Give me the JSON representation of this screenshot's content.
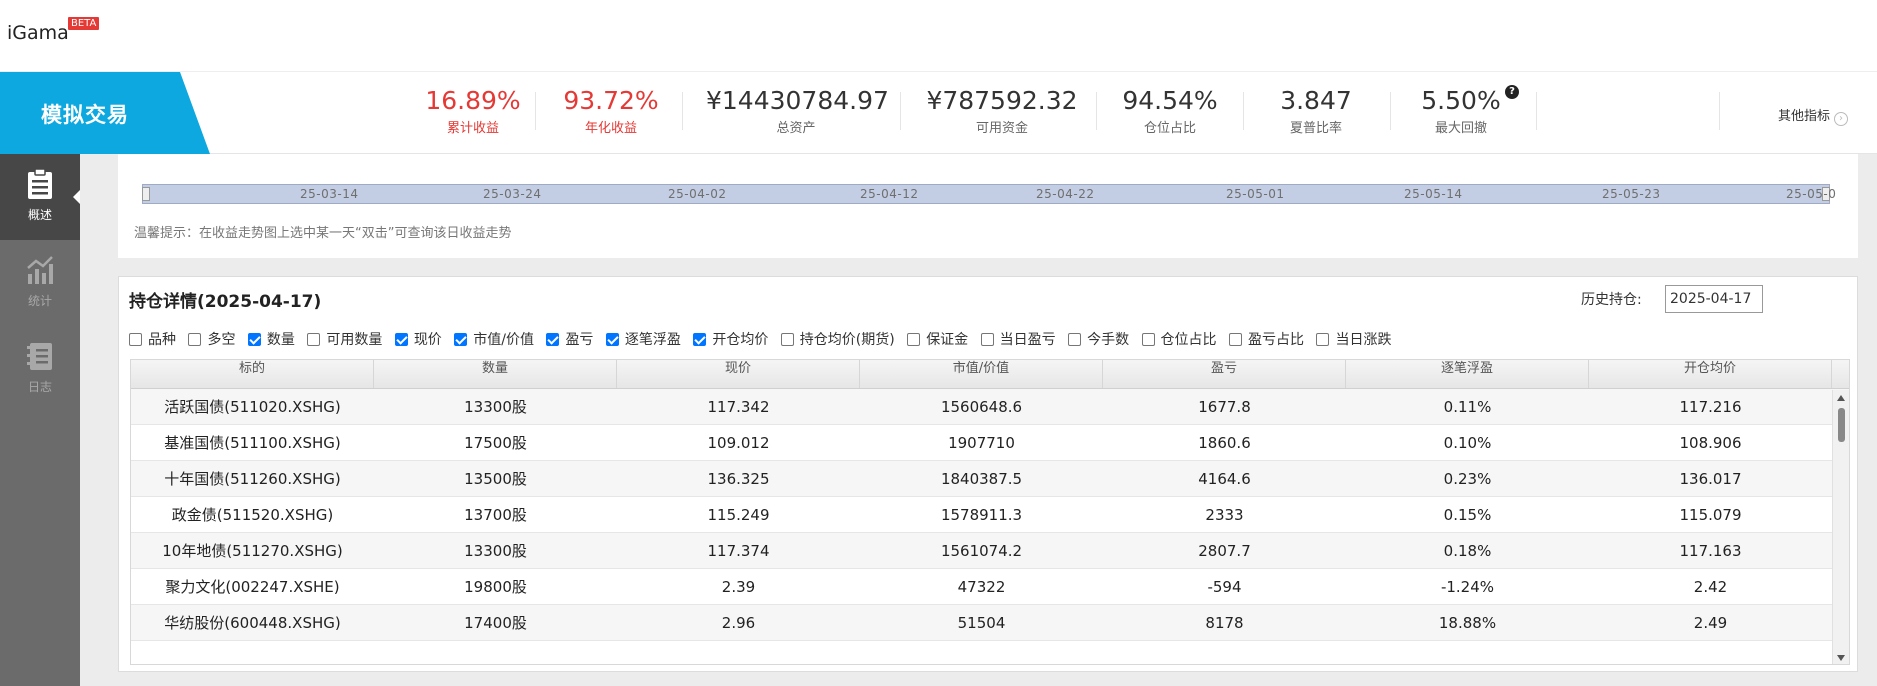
{
  "app": {
    "name": "iGama",
    "badge": "BETA"
  },
  "mode_tab": "模拟交易",
  "stats": [
    {
      "value": "16.89%",
      "label": "累计收益",
      "highlight": true
    },
    {
      "value": "93.72%",
      "label": "年化收益",
      "highlight": true
    },
    {
      "value": "¥14430784.97",
      "label": "总资产",
      "highlight": false
    },
    {
      "value": "¥787592.32",
      "label": "可用资金",
      "highlight": false
    },
    {
      "value": "94.54%",
      "label": "仓位占比",
      "highlight": false
    },
    {
      "value": "3.847",
      "label": "夏普比率",
      "highlight": false
    },
    {
      "value": "5.50%",
      "label": "最大回撤",
      "highlight": false
    }
  ],
  "more_metrics": "其他指标",
  "sidebar": [
    {
      "label": "概述",
      "icon": "clipboard-icon",
      "active": true
    },
    {
      "label": "统计",
      "icon": "chart-icon",
      "active": false
    },
    {
      "label": "日志",
      "icon": "log-icon",
      "active": false
    }
  ],
  "timeline": {
    "ticks": [
      "25-03-14",
      "25-03-24",
      "25-04-02",
      "25-04-12",
      "25-04-22",
      "25-05-01",
      "25-05-14",
      "25-05-23",
      "25-05-0"
    ],
    "tip": "温馨提示：在收益走势图上选中某一天“双击”可查询该日收益走势"
  },
  "holdings": {
    "title": "持仓详情(2025-04-17)",
    "history_label": "历史持仓:",
    "history_date": "2025-04-17",
    "filters": [
      {
        "label": "品种",
        "checked": false
      },
      {
        "label": "多空",
        "checked": false
      },
      {
        "label": "数量",
        "checked": true
      },
      {
        "label": "可用数量",
        "checked": false
      },
      {
        "label": "现价",
        "checked": true
      },
      {
        "label": "市值/价值",
        "checked": true
      },
      {
        "label": "盈亏",
        "checked": true
      },
      {
        "label": "逐笔浮盈",
        "checked": true
      },
      {
        "label": "开仓均价",
        "checked": true
      },
      {
        "label": "持仓均价(期货)",
        "checked": false
      },
      {
        "label": "保证金",
        "checked": false
      },
      {
        "label": "当日盈亏",
        "checked": false
      },
      {
        "label": "今手数",
        "checked": false
      },
      {
        "label": "仓位占比",
        "checked": false
      },
      {
        "label": "盈亏占比",
        "checked": false
      },
      {
        "label": "当日涨跌",
        "checked": false
      }
    ],
    "columns": [
      "标的",
      "数量",
      "现价",
      "市值/价值",
      "盈亏",
      "逐笔浮盈",
      "开仓均价"
    ],
    "rows": [
      [
        "活跃国债(511020.XSHG)",
        "13300股",
        "117.342",
        "1560648.6",
        "1677.8",
        "0.11%",
        "117.216"
      ],
      [
        "基准国债(511100.XSHG)",
        "17500股",
        "109.012",
        "1907710",
        "1860.6",
        "0.10%",
        "108.906"
      ],
      [
        "十年国债(511260.XSHG)",
        "13500股",
        "136.325",
        "1840387.5",
        "4164.6",
        "0.23%",
        "136.017"
      ],
      [
        "政金债(511520.XSHG)",
        "13700股",
        "115.249",
        "1578911.3",
        "2333",
        "0.15%",
        "115.079"
      ],
      [
        "10年地债(511270.XSHG)",
        "13300股",
        "117.374",
        "1561074.2",
        "2807.7",
        "0.18%",
        "117.163"
      ],
      [
        "聚力文化(002247.XSHE)",
        "19800股",
        "2.39",
        "47322",
        "-594",
        "-1.24%",
        "2.42"
      ],
      [
        "华纺股份(600448.XSHG)",
        "17400股",
        "2.96",
        "51504",
        "8178",
        "18.88%",
        "2.49"
      ]
    ]
  },
  "colors": {
    "accent": "#0da8e0",
    "positive": "#e53935",
    "sidebar": "#6b6b6b",
    "sidebar_active": "#474747",
    "checkbox": "#0075ff"
  }
}
